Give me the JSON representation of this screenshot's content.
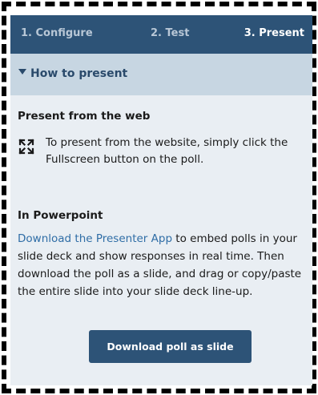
{
  "tabs": [
    {
      "label": "1. Configure",
      "active": false
    },
    {
      "label": "2. Test",
      "active": false
    },
    {
      "label": "3. Present",
      "active": true
    }
  ],
  "accordion": {
    "title": "How to present",
    "expanded": true
  },
  "web_section": {
    "title": "Present from the web",
    "icon": "fullscreen-icon",
    "text": "To present from the website, simply click the Fullscreen button on the poll."
  },
  "powerpoint_section": {
    "title": "In Powerpoint",
    "link_text": "Download the Presenter App",
    "text": " to embed polls in your slide deck and show responses in real time. Then download the poll as a slide, and drag or copy/paste the entire slide into your slide deck line-up."
  },
  "download_button": {
    "label": "Download poll as slide"
  },
  "colors": {
    "tabbar_bg": "#2d5377",
    "accordion_bg": "#c7d6e2",
    "panel_bg": "#e9eef3",
    "link": "#2f6da6",
    "button_bg": "#2d5377"
  }
}
